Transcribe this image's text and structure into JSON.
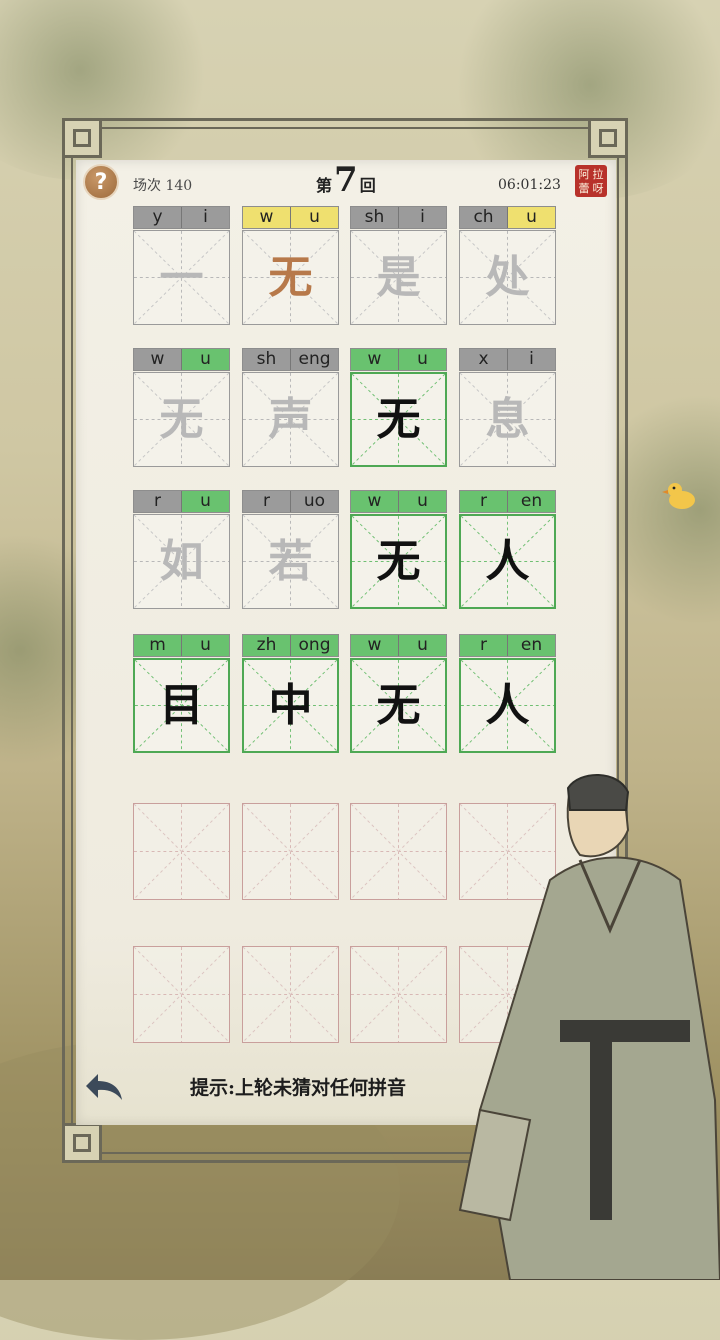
{
  "header": {
    "help_label": "?",
    "round_count": "场次 140",
    "title_prefix": "第",
    "title_number": "7",
    "title_suffix": "回",
    "timer": "06:01:23",
    "seal_chars": [
      "阿",
      "拉",
      "蕾",
      "呀"
    ]
  },
  "colors": {
    "gray": "#9b9b9b",
    "yellow": "#efe06f",
    "green": "#69c26f",
    "char_orange": "#b7794a"
  },
  "rows": [
    {
      "tiles": [
        {
          "initial": "y",
          "final": "i",
          "initial_state": "gray",
          "final_state": "gray",
          "char": "一",
          "char_state": "faded"
        },
        {
          "initial": "w",
          "final": "u",
          "initial_state": "yellow",
          "final_state": "yellow",
          "char": "无",
          "char_state": "orange"
        },
        {
          "initial": "sh",
          "final": "i",
          "initial_state": "gray",
          "final_state": "gray",
          "char": "是",
          "char_state": "faded"
        },
        {
          "initial": "ch",
          "final": "u",
          "initial_state": "gray",
          "final_state": "yellow",
          "char": "处",
          "char_state": "faded"
        }
      ]
    },
    {
      "tiles": [
        {
          "initial": "w",
          "final": "u",
          "initial_state": "gray",
          "final_state": "green",
          "char": "无",
          "char_state": "faded"
        },
        {
          "initial": "sh",
          "final": "eng",
          "initial_state": "gray",
          "final_state": "gray",
          "char": "声",
          "char_state": "faded"
        },
        {
          "initial": "w",
          "final": "u",
          "initial_state": "green",
          "final_state": "green",
          "char": "无",
          "char_state": "black"
        },
        {
          "initial": "x",
          "final": "i",
          "initial_state": "gray",
          "final_state": "gray",
          "char": "息",
          "char_state": "faded"
        }
      ]
    },
    {
      "tiles": [
        {
          "initial": "r",
          "final": "u",
          "initial_state": "gray",
          "final_state": "green",
          "char": "如",
          "char_state": "faded"
        },
        {
          "initial": "r",
          "final": "uo",
          "initial_state": "gray",
          "final_state": "gray",
          "char": "若",
          "char_state": "faded"
        },
        {
          "initial": "w",
          "final": "u",
          "initial_state": "green",
          "final_state": "green",
          "char": "无",
          "char_state": "black"
        },
        {
          "initial": "r",
          "final": "en",
          "initial_state": "green",
          "final_state": "green",
          "char": "人",
          "char_state": "black"
        }
      ]
    },
    {
      "tiles": [
        {
          "initial": "m",
          "final": "u",
          "initial_state": "green",
          "final_state": "green",
          "char": "目",
          "char_state": "black"
        },
        {
          "initial": "zh",
          "final": "ong",
          "initial_state": "green",
          "final_state": "green",
          "char": "中",
          "char_state": "black"
        },
        {
          "initial": "w",
          "final": "u",
          "initial_state": "green",
          "final_state": "green",
          "char": "无",
          "char_state": "black"
        },
        {
          "initial": "r",
          "final": "en",
          "initial_state": "green",
          "final_state": "green",
          "char": "人",
          "char_state": "black"
        }
      ]
    }
  ],
  "empty_rows": 2,
  "footer": {
    "hint": "提示:上轮未猜对任何拼音"
  }
}
